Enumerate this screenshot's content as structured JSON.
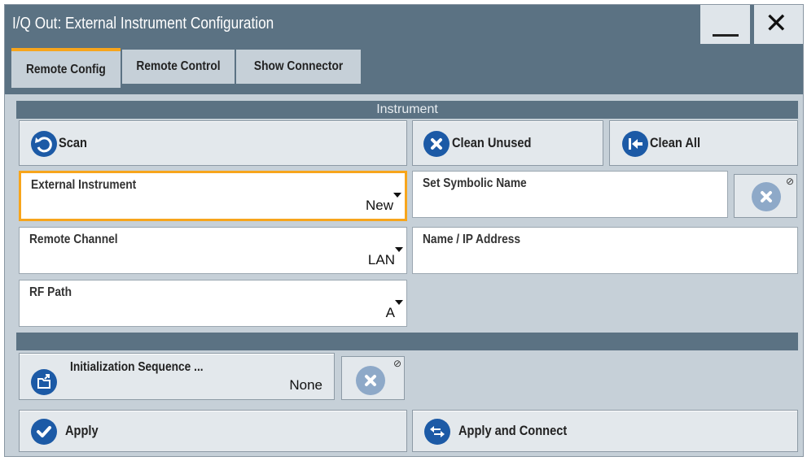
{
  "window": {
    "title": "I/Q Out: External Instrument Configuration",
    "minimize_glyph": "",
    "close_glyph": "✕"
  },
  "tabs": [
    {
      "label": "Remote Config",
      "active": true
    },
    {
      "label": "Remote Control",
      "active": false
    },
    {
      "label": "Show Connector",
      "active": false
    }
  ],
  "sections": {
    "instrument": "Instrument",
    "second": ""
  },
  "buttons": {
    "scan": "Scan",
    "clean_unused": "Clean Unused",
    "clean_all": "Clean All",
    "init_seq_label": "Initialization Sequence ...",
    "init_seq_value": "None",
    "apply": "Apply",
    "apply_connect": "Apply and Connect"
  },
  "fields": {
    "external_instrument": {
      "label": "External Instrument",
      "value": "New"
    },
    "remote_channel": {
      "label": "Remote Channel",
      "value": "LAN"
    },
    "rf_path": {
      "label": "RF Path",
      "value": "A"
    },
    "symbolic_name": {
      "label": "Set Symbolic Name",
      "value": ""
    },
    "ip_address": {
      "label": "Name / IP Address",
      "value": ""
    }
  },
  "colors": {
    "accent": "#f7a51c",
    "header": "#5b7283",
    "panel": "#c6d0d8",
    "icon_blue": "#1c5aa6",
    "icon_disabled": "#8ea9c8"
  },
  "icons": {
    "scan": "refresh-icon",
    "clean_unused": "x-circle-icon",
    "clean_all": "arrow-to-left-icon",
    "init_seq": "folder-open-icon",
    "apply": "checkmark-icon",
    "apply_connect": "bidirectional-arrows-icon",
    "clear": "x-circle-icon"
  }
}
